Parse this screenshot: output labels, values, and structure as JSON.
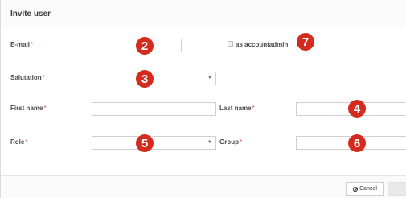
{
  "dialog": {
    "title": "Invite user",
    "fields": {
      "email": {
        "label": "E-mail",
        "required": "*"
      },
      "salutation": {
        "label": "Salutation",
        "required": "*"
      },
      "first_name": {
        "label": "First name",
        "required": "*"
      },
      "last_name": {
        "label": "Last name",
        "required": "*"
      },
      "role": {
        "label": "Role",
        "required": "*"
      },
      "group": {
        "label": "Group",
        "required": "*"
      }
    },
    "accountadmin_checkbox": {
      "label": "as accountadmin",
      "checked": false
    },
    "callouts": [
      "2",
      "3",
      "4",
      "5",
      "6",
      "7"
    ],
    "buttons": {
      "cancel": "Cancel"
    }
  },
  "colors": {
    "callout": "#d52b1e",
    "required": "#d9534f"
  },
  "icons": {
    "cancel": "cancel-icon",
    "select_caret": "caret-down-icon"
  }
}
